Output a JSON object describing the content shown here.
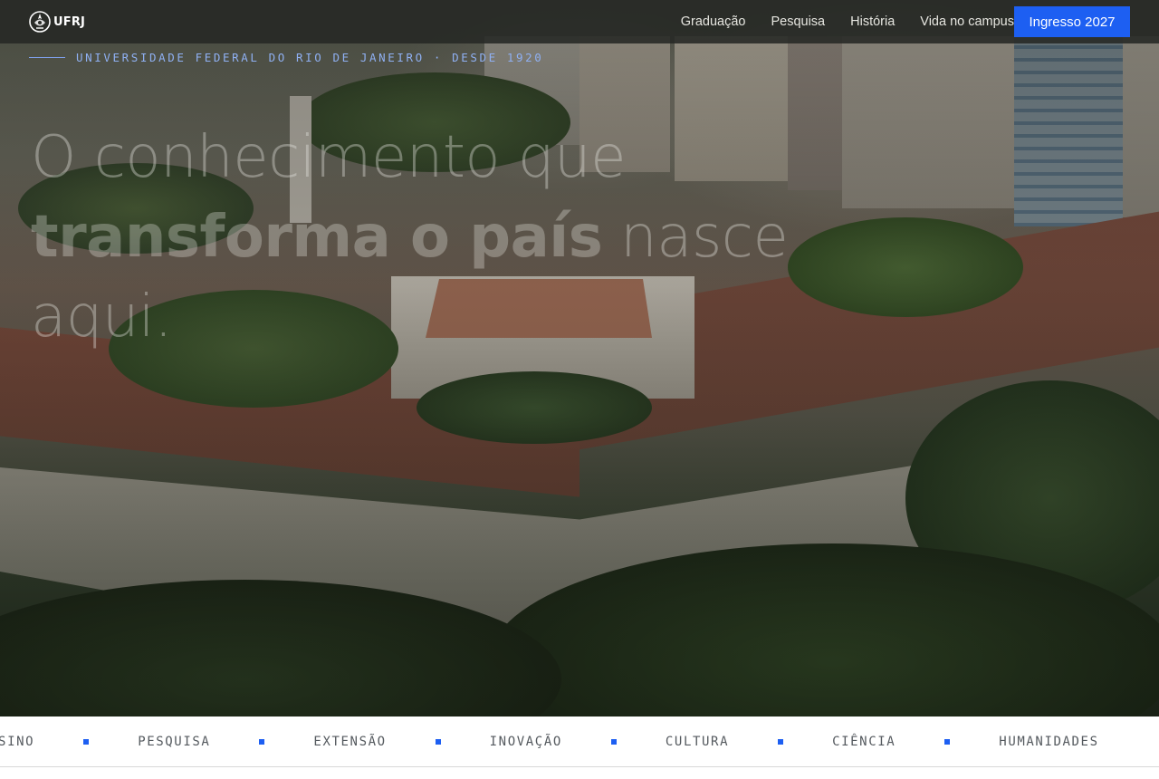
{
  "brand": {
    "logo_text": "UFRJ",
    "accent_color": "#1d5ff2"
  },
  "nav": {
    "items": [
      {
        "label": "Graduação"
      },
      {
        "label": "Pesquisa"
      },
      {
        "label": "História"
      },
      {
        "label": "Vida no campus"
      }
    ],
    "cta_label": "Ingresso 2027"
  },
  "hero": {
    "eyebrow": "UNIVERSIDADE FEDERAL DO RIO DE JANEIRO · DESDE 1920",
    "headline_part1": "O conhecimento que",
    "headline_strong": "transforma o país",
    "headline_part2": "nasce aqui",
    "headline_end": "."
  },
  "ticker": {
    "items": [
      "ENSINO",
      "PESQUISA",
      "EXTENSÃO",
      "INOVAÇÃO",
      "CULTURA",
      "CIÊNCIA",
      "HUMANIDADES"
    ]
  }
}
